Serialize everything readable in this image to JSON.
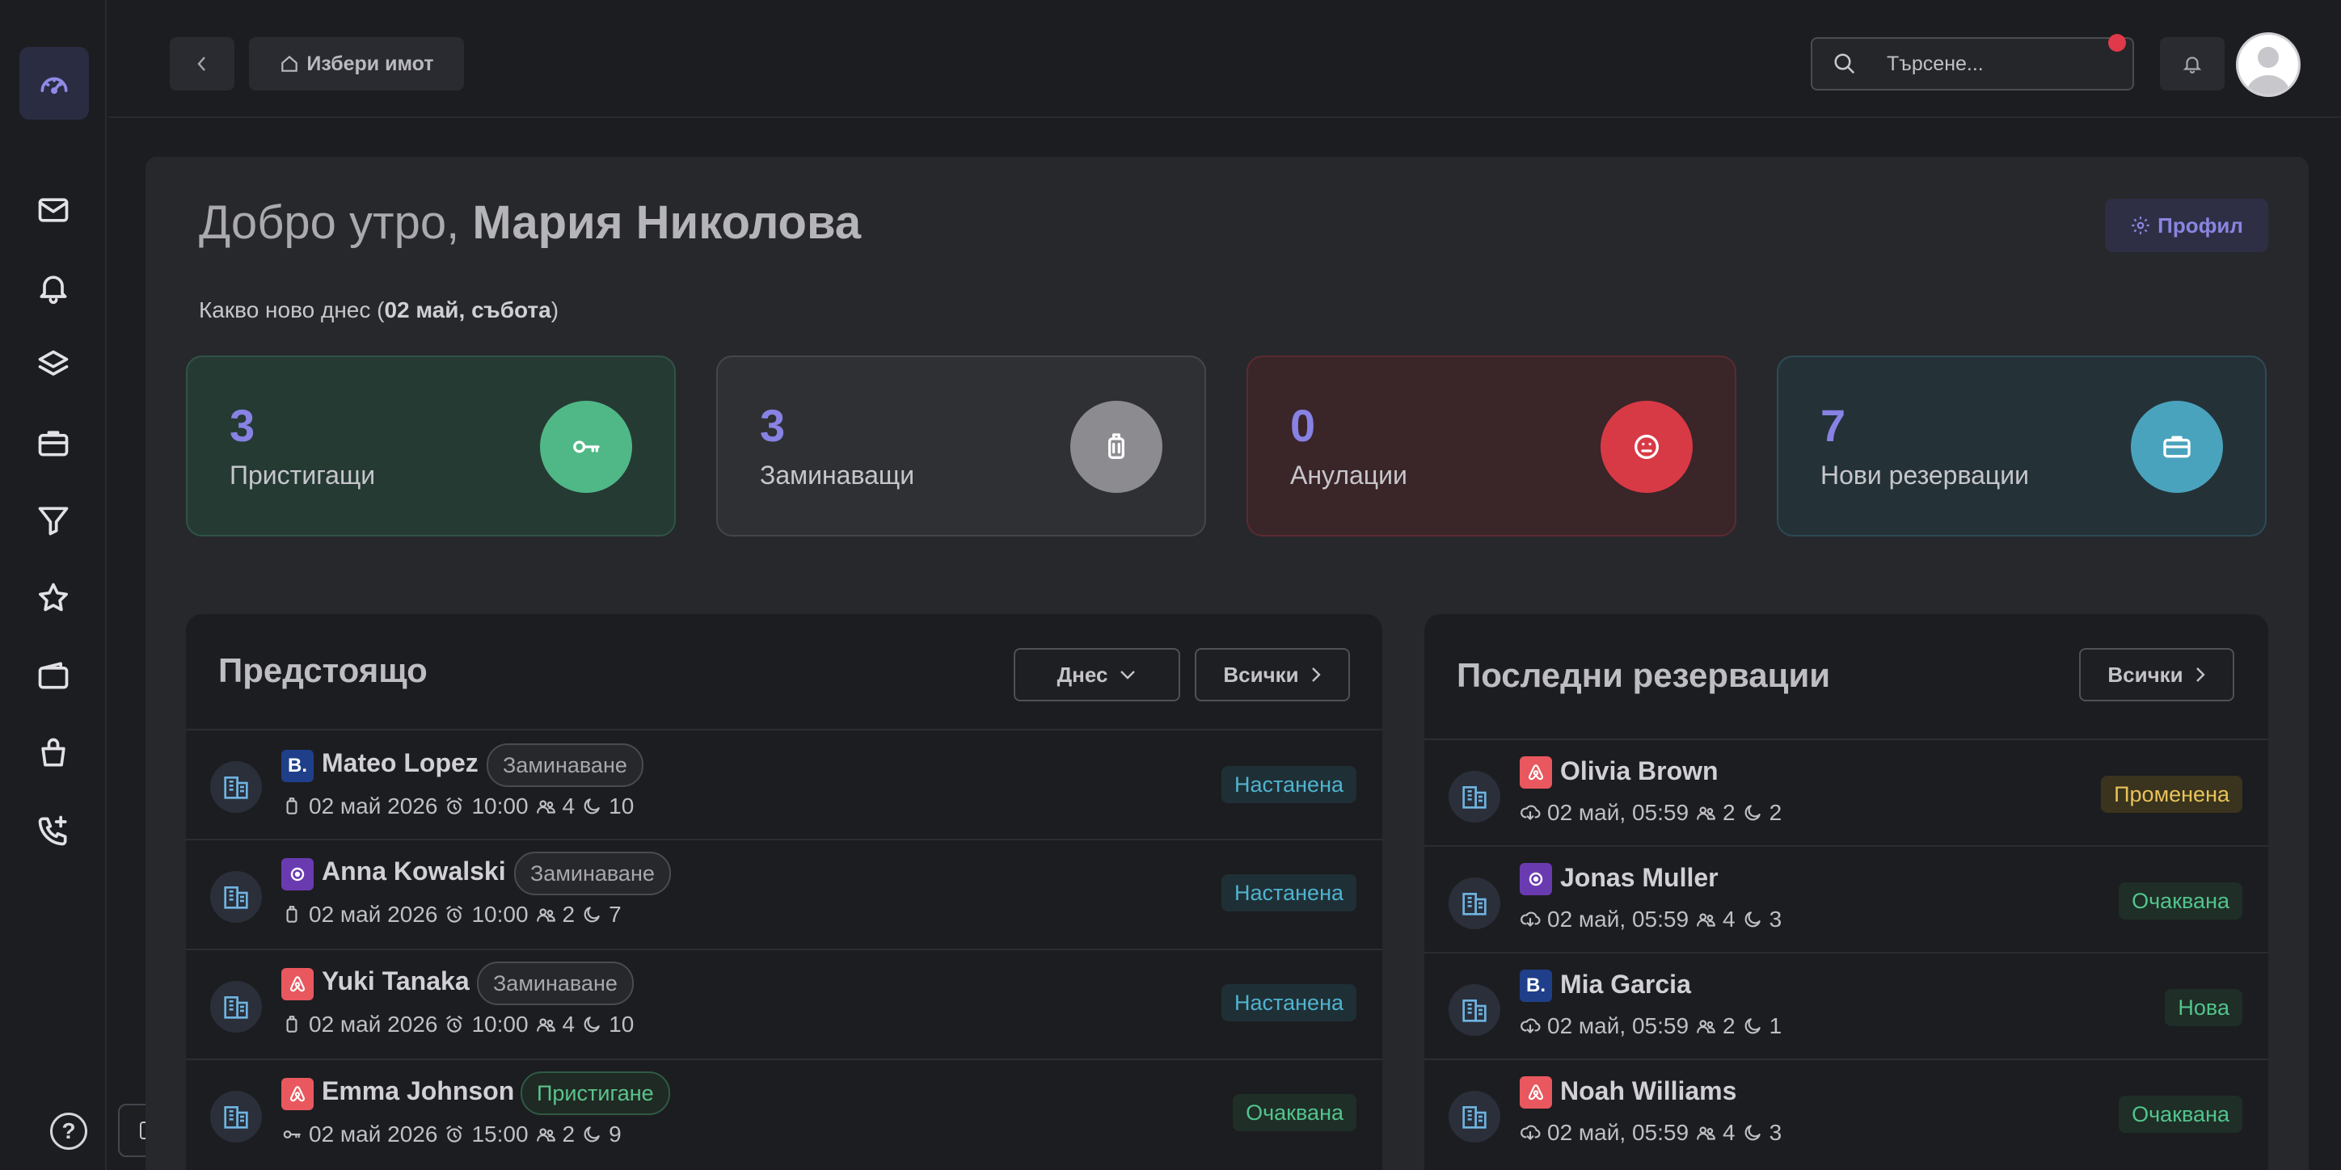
{
  "topbar": {
    "choose_property": "Избери имот",
    "search_placeholder": "Търсене..."
  },
  "greeting": {
    "prefix": "Добро утро, ",
    "name": "Мария Николова",
    "sub_prefix": "Какво ново днес (",
    "date": "02 май, събота",
    "sub_suffix": ")",
    "profile_label": "Профил"
  },
  "stats": [
    {
      "value": "3",
      "label": "Пристигащи",
      "icon": "key-icon"
    },
    {
      "value": "3",
      "label": "Заминаващи",
      "icon": "luggage-icon"
    },
    {
      "value": "0",
      "label": "Анулации",
      "icon": "neutral-face-icon"
    },
    {
      "value": "7",
      "label": "Нови резервации",
      "icon": "briefcase-icon"
    }
  ],
  "upcoming": {
    "title": "Предстоящо",
    "filter_value": "Днес",
    "all_label": "Всички",
    "rows": [
      {
        "source": "booking",
        "name": "Mateo Lopez",
        "tag": "Заминаване",
        "date": "02 май 2026",
        "time": "10:00",
        "guests": "4",
        "nights": "10",
        "status": "Настанена"
      },
      {
        "source": "other",
        "name": "Anna Kowalski",
        "tag": "Заминаване",
        "date": "02 май 2026",
        "time": "10:00",
        "guests": "2",
        "nights": "7",
        "status": "Настанена"
      },
      {
        "source": "airbnb",
        "name": "Yuki Tanaka",
        "tag": "Заминаване",
        "date": "02 май 2026",
        "time": "10:00",
        "guests": "4",
        "nights": "10",
        "status": "Настанена"
      },
      {
        "source": "airbnb",
        "name": "Emma Johnson",
        "tag": "Пристигане",
        "date": "02 май 2026",
        "time": "15:00",
        "guests": "2",
        "nights": "9",
        "status": "Очаквана"
      }
    ]
  },
  "recent": {
    "title": "Последни резервации",
    "all_label": "Всички",
    "rows": [
      {
        "source": "airbnb",
        "name": "Olivia Brown",
        "date": "02 май, 05:59",
        "guests": "2",
        "nights": "2",
        "status": "Променена"
      },
      {
        "source": "other",
        "name": "Jonas Muller",
        "date": "02 май, 05:59",
        "guests": "4",
        "nights": "3",
        "status": "Очаквана"
      },
      {
        "source": "booking",
        "name": "Mia Garcia",
        "date": "02 май, 05:59",
        "guests": "2",
        "nights": "1",
        "status": "Нова"
      },
      {
        "source": "airbnb",
        "name": "Noah Williams",
        "date": "02 май, 05:59",
        "guests": "4",
        "nights": "3",
        "status": "Очаквана"
      }
    ]
  },
  "colors": {
    "accent": "#8782e4",
    "arrivals": "#4fb886",
    "departures": "#8b8b90",
    "cancellations": "#d83a45",
    "new_bookings": "#4aa3bd"
  }
}
